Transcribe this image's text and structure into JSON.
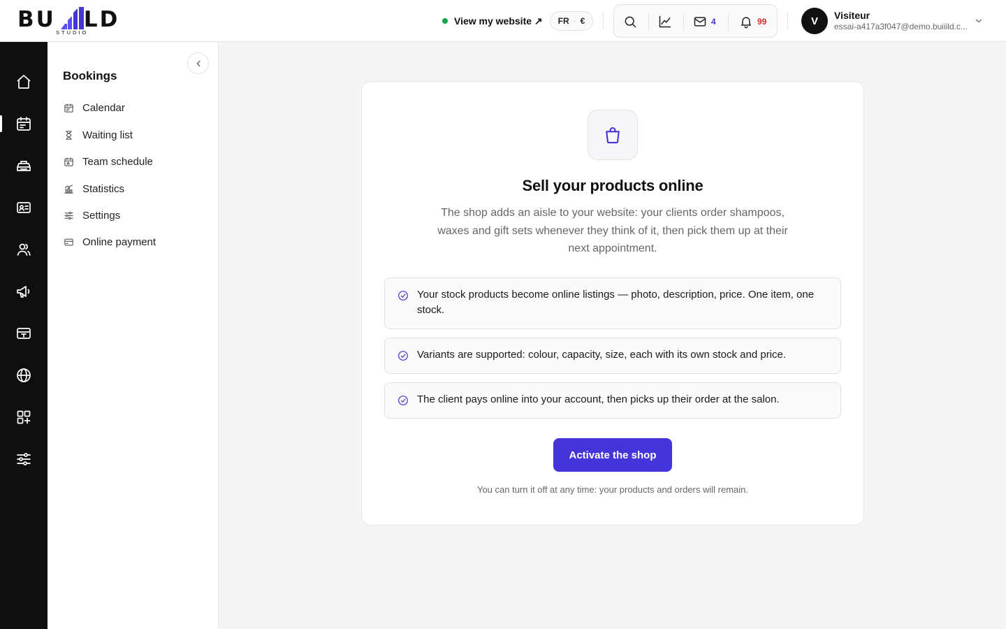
{
  "brand": {
    "logo_text_left": "BU",
    "logo_text_right": "LD",
    "logo_sub": "STUDIO"
  },
  "header": {
    "view_site_label": "View my website ↗",
    "lang": "FR",
    "currency": "€",
    "messages_count": "4",
    "notifications_count": "99",
    "user": {
      "initial": "V",
      "name": "Visiteur",
      "email": "essai-a417a3f047@demo.buiiild.c..."
    }
  },
  "rail": {
    "items": [
      "home-icon",
      "calendar-icon",
      "services-icon",
      "contact-card-icon",
      "clients-icon",
      "megaphone-icon",
      "payment-terminal-icon",
      "globe-icon",
      "apps-icon",
      "settings-sliders-icon"
    ],
    "active": "calendar-icon"
  },
  "subnav": {
    "title": "Bookings",
    "items": [
      {
        "label": "Calendar",
        "icon": "calendar-icon"
      },
      {
        "label": "Waiting list",
        "icon": "hourglass-icon"
      },
      {
        "label": "Team schedule",
        "icon": "team-calendar-icon"
      },
      {
        "label": "Statistics",
        "icon": "statistics-icon"
      },
      {
        "label": "Settings",
        "icon": "sliders-icon"
      },
      {
        "label": "Online payment",
        "icon": "credit-card-icon"
      }
    ]
  },
  "card": {
    "title": "Sell your products online",
    "description": "The shop adds an aisle to your website: your clients order shampoos, waxes and gift sets whenever they think of it, then pick them up at their next appointment.",
    "features": [
      "Your stock products become online listings — photo, description, price. One item, one stock.",
      "Variants are supported: colour, capacity, size, each with its own stock and price.",
      "The client pays online into your account, then picks up their order at the salon."
    ],
    "cta_label": "Activate the shop",
    "footnote": "You can turn it off at any time: your products and orders will remain."
  },
  "colors": {
    "accent": "#4535d8",
    "online_dot": "#1aa34a",
    "notification": "#d92d2d",
    "rail_bg": "#0f0f10"
  }
}
